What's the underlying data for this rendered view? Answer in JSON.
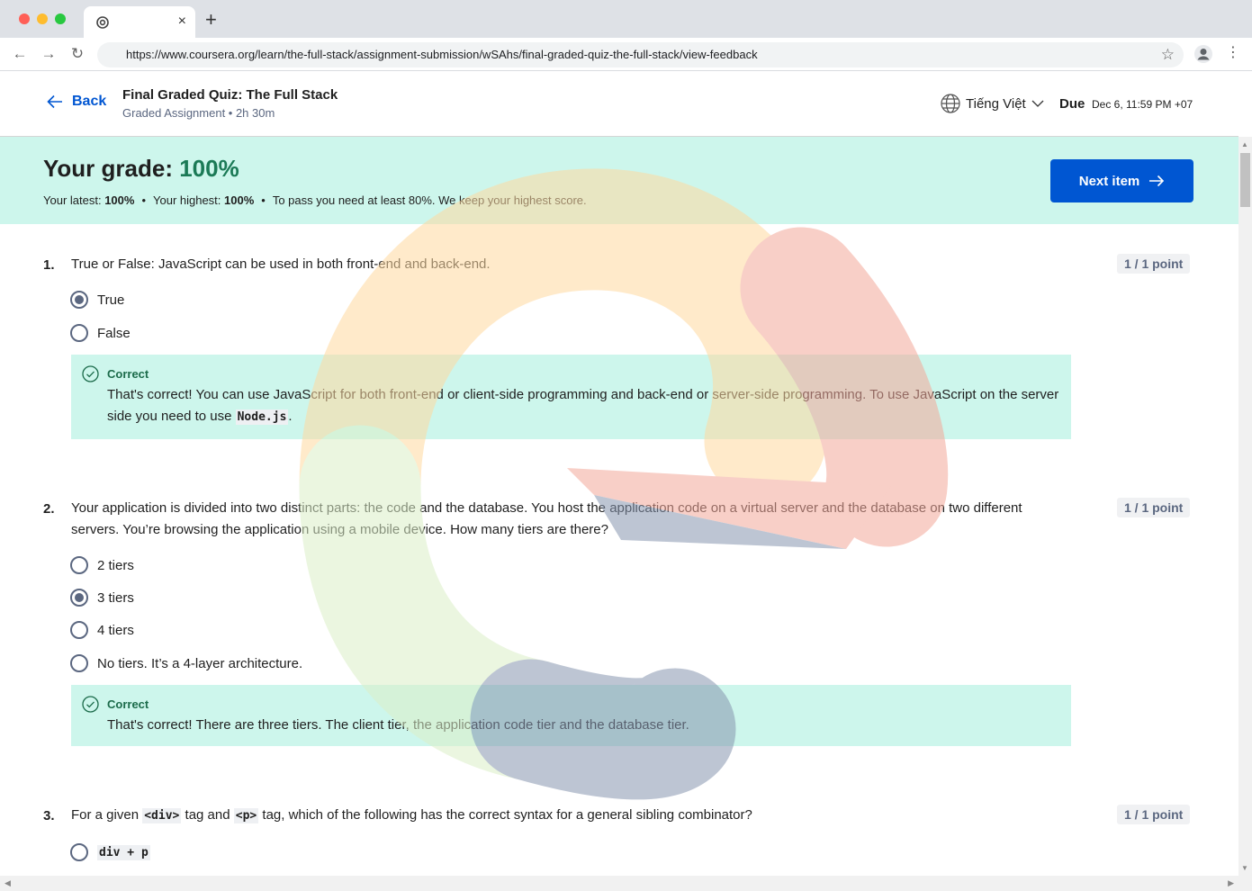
{
  "browser": {
    "url": "https://www.coursera.org/learn/the-full-stack/assignment-submission/wSAhs/final-graded-quiz-the-full-stack/view-feedback",
    "tab_close": "×",
    "new_tab": "+"
  },
  "header": {
    "back_label": "Back",
    "title": "Final Graded Quiz: The Full Stack",
    "subtitle": "Graded Assignment • 2h 30m",
    "language": "Tiếng Việt",
    "due_label": "Due",
    "due_value": "Dec 6, 11:59 PM +07"
  },
  "grade": {
    "label": "Your grade: ",
    "value": "100%",
    "latest_label": "Your latest: ",
    "latest_value": "100%",
    "highest_label": "Your highest: ",
    "highest_value": "100%",
    "pass_note": "To pass you need at least 80%. We keep your highest score.",
    "next_label": "Next item"
  },
  "questions": [
    {
      "num": "1.",
      "text": "True or False:  JavaScript can be used in both front-end and back-end.",
      "points": "1 / 1 point",
      "options": [
        "True",
        "False"
      ],
      "selected": 0,
      "feedback_label": "Correct",
      "feedback_text_1": "That's correct! You can use JavaScript for both front-end or client-side programming and back-end or server-side programming. To use JavaScript on the server side you need to use ",
      "feedback_code": "Node.js",
      "feedback_text_2": "."
    },
    {
      "num": "2.",
      "text": "Your application is divided into two distinct parts: the code and the database. You host the application code on a virtual server and the database on two different servers. You’re browsing the application using a mobile device. How many tiers are there?",
      "points": "1 / 1 point",
      "options": [
        "2 tiers",
        "3 tiers",
        "4 tiers",
        "No tiers. It’s a 4-layer architecture."
      ],
      "selected": 1,
      "feedback_label": "Correct",
      "feedback_text": "That's correct! There are three tiers. The client tier, the application code tier and the database tier."
    },
    {
      "num": "3.",
      "text_1": "For a given ",
      "code_1": "<div>",
      "text_2": " tag and ",
      "code_2": "<p>",
      "text_3": " tag, which of the following has the correct syntax for a general sibling combinator?",
      "points": "1 / 1 point",
      "options": [
        "div + p"
      ]
    }
  ],
  "colors": {
    "accent": "#0056d2",
    "banner": "#cdf6ec",
    "correct_text": "#1b6b4a"
  }
}
